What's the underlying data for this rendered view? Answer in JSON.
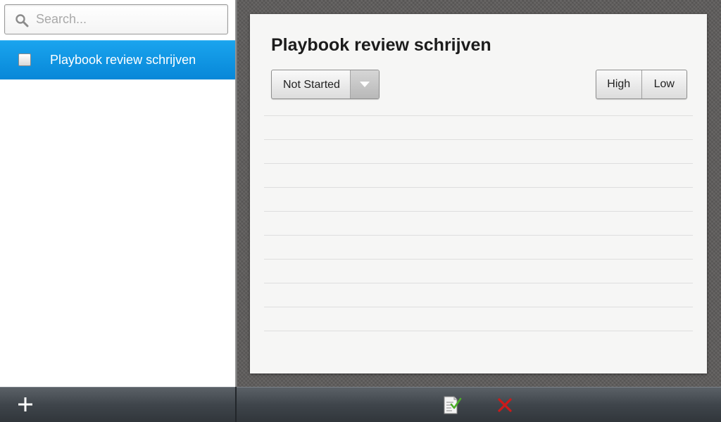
{
  "search": {
    "placeholder": "Search..."
  },
  "tasks": [
    {
      "label": "Playbook review schrijven",
      "selected": true,
      "checked": false
    }
  ],
  "detail": {
    "title": "Playbook review schrijven",
    "status": "Not Started",
    "priority_options": [
      "High",
      "Low"
    ]
  },
  "toolbar": {
    "add_icon": "plus-icon",
    "save_icon": "save-note-icon",
    "delete_icon": "delete-x-icon"
  },
  "colors": {
    "accent": "#0f95e4",
    "delete": "#cc1a1a",
    "check": "#4caf28"
  }
}
